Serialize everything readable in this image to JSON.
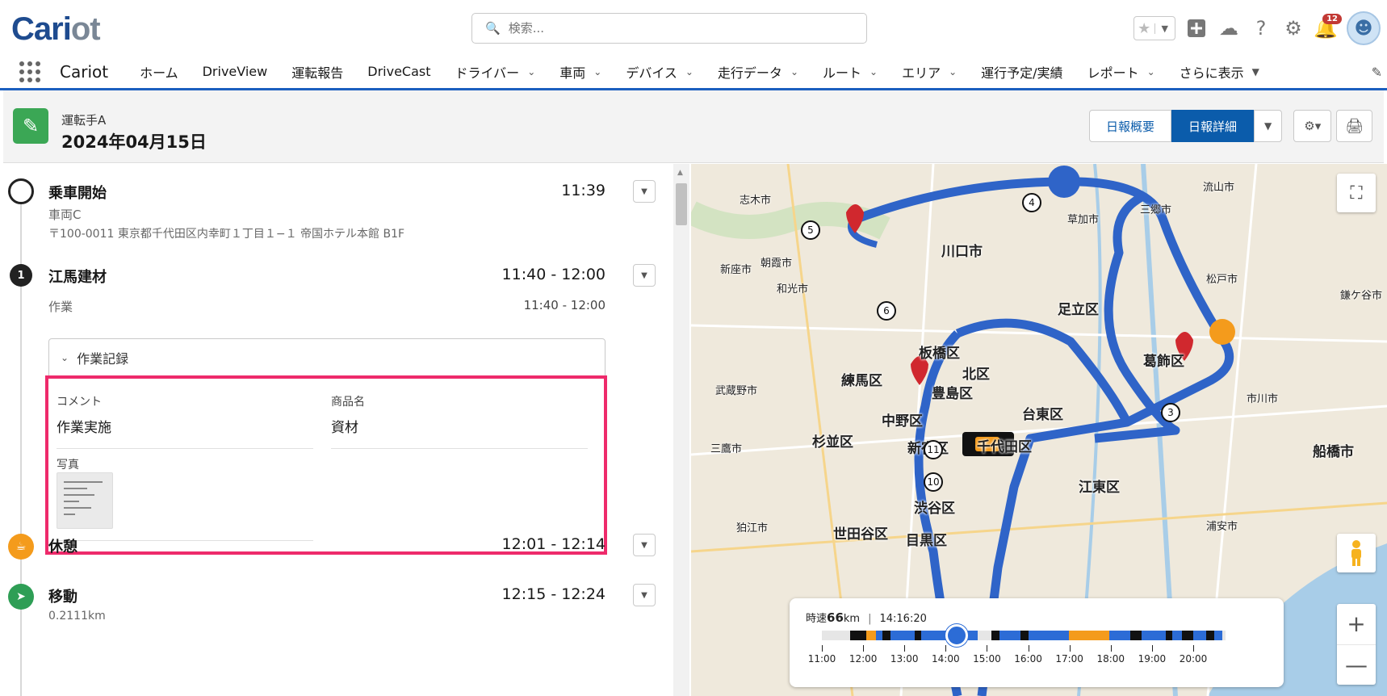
{
  "topbar": {
    "logo_a": "Cari",
    "logo_b": "ot",
    "search_placeholder": "検索...",
    "notification_count": "12"
  },
  "nav": {
    "app_name": "Cariot",
    "items": [
      {
        "label": "ホーム",
        "dropdown": false
      },
      {
        "label": "DriveView",
        "dropdown": false
      },
      {
        "label": "運転報告",
        "dropdown": false
      },
      {
        "label": "DriveCast",
        "dropdown": false
      },
      {
        "label": "ドライバー",
        "dropdown": true
      },
      {
        "label": "車両",
        "dropdown": true
      },
      {
        "label": "デバイス",
        "dropdown": true
      },
      {
        "label": "走行データ",
        "dropdown": true
      },
      {
        "label": "ルート",
        "dropdown": true
      },
      {
        "label": "エリア",
        "dropdown": true
      },
      {
        "label": "運行予定/実績",
        "dropdown": false
      },
      {
        "label": "レポート",
        "dropdown": true
      },
      {
        "label": "さらに表示",
        "dropdown": true
      }
    ]
  },
  "header": {
    "subtitle": "運転手A",
    "title": "2024年04月15日",
    "btn_summary": "日報概要",
    "btn_detail": "日報詳細"
  },
  "events": {
    "start": {
      "title": "乗車開始",
      "time": "11:39",
      "vehicle": "車両C",
      "address": "〒100-0011 東京都千代田区内幸町１丁目１−１ 帝国ホテル本館 B1F"
    },
    "stop1": {
      "num": "1",
      "title": "江馬建材",
      "time": "11:40 - 12:00",
      "sub": "作業",
      "sub_time": "11:40 - 12:00"
    },
    "work_record": {
      "label": "作業記録",
      "comment_label": "コメント",
      "comment_value": "作業実施",
      "product_label": "商品名",
      "product_value": "資材",
      "photo_label": "写真"
    },
    "rest": {
      "title": "休憩",
      "time": "12:01 - 12:14"
    },
    "move": {
      "title": "移動",
      "time": "12:15 - 12:24",
      "distance": "0.2111km"
    }
  },
  "map": {
    "labels": [
      {
        "text": "川口市"
      },
      {
        "text": "足立区"
      },
      {
        "text": "板橋区"
      },
      {
        "text": "北区"
      },
      {
        "text": "練馬区"
      },
      {
        "text": "葛飾区"
      },
      {
        "text": "豊島区"
      },
      {
        "text": "中野区"
      },
      {
        "text": "台東区"
      },
      {
        "text": "杉並区"
      },
      {
        "text": "新宿区"
      },
      {
        "text": "千代田区"
      },
      {
        "text": "江東区"
      },
      {
        "text": "渋谷区"
      },
      {
        "text": "世田谷区"
      },
      {
        "text": "目黒区"
      },
      {
        "text": "船橋市"
      },
      {
        "text": "志木市"
      },
      {
        "text": "新座市"
      },
      {
        "text": "朝霞市"
      },
      {
        "text": "和光市"
      },
      {
        "text": "草加市"
      },
      {
        "text": "三郷市"
      },
      {
        "text": "流山市"
      },
      {
        "text": "松戸市"
      },
      {
        "text": "市川市"
      },
      {
        "text": "鎌ケ谷市"
      },
      {
        "text": "武蔵野市"
      },
      {
        "text": "三鷹市"
      },
      {
        "text": "狛江市"
      },
      {
        "text": "浦安市"
      }
    ],
    "stops": [
      "3",
      "4",
      "5",
      "6",
      "10",
      "11"
    ],
    "speed": {
      "prefix": "時速",
      "value": "66",
      "unit": "km",
      "time": "14:16:20"
    },
    "ticks": [
      "11:00",
      "12:00",
      "13:00",
      "14:00",
      "15:00",
      "16:00",
      "17:00",
      "18:00",
      "19:00",
      "20:00"
    ],
    "playhead_time": "14:16:20"
  },
  "colors": {
    "accent": "#0b5cab",
    "highlight": "#ee2a6b",
    "route": "#2f64c8",
    "rest": "#f49b1c",
    "move": "#2e9e55"
  }
}
